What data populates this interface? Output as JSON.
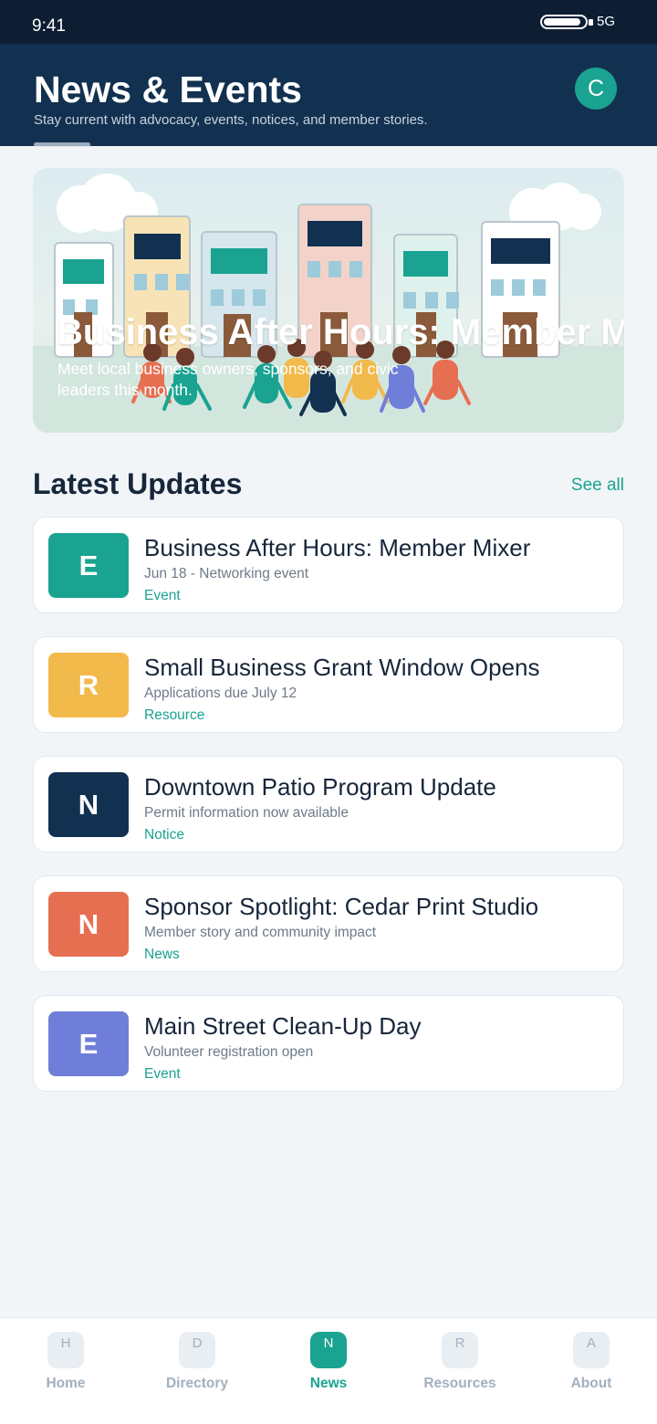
{
  "status": {
    "time": "9:41",
    "network": "5G",
    "battery_level": 0.9
  },
  "header": {
    "title": "News & Events",
    "subtitle": "Stay current with advocacy, events, notices, and member stories.",
    "avatar_initial": "C"
  },
  "hero": {
    "title": "Business After Hours: Member Mixer",
    "subtitle": "Meet local business owners, sponsors, and civic leaders this month."
  },
  "section": {
    "title": "Latest Updates",
    "see_all": "See all"
  },
  "updates": [
    {
      "badge": "E",
      "color": "#1aa391",
      "title": "Business After Hours: Member Mixer",
      "meta": "Jun 18 - Networking event",
      "tag": "Event"
    },
    {
      "badge": "R",
      "color": "#f2b94b",
      "title": "Small Business Grant Window Opens",
      "meta": "Applications due July 12",
      "tag": "Resource"
    },
    {
      "badge": "N",
      "color": "#123150",
      "title": "Downtown Patio Program Update",
      "meta": "Permit information now available",
      "tag": "Notice"
    },
    {
      "badge": "N",
      "color": "#e76f51",
      "title": "Sponsor Spotlight: Cedar Print Studio",
      "meta": "Member story and community impact",
      "tag": "News"
    },
    {
      "badge": "E",
      "color": "#6f7fd9",
      "title": "Main Street Clean-Up Day",
      "meta": "Volunteer registration open",
      "tag": "Event"
    }
  ],
  "tabs": [
    {
      "letter": "H",
      "label": "Home"
    },
    {
      "letter": "D",
      "label": "Directory"
    },
    {
      "letter": "N",
      "label": "News",
      "active": true
    },
    {
      "letter": "R",
      "label": "Resources"
    },
    {
      "letter": "A",
      "label": "About"
    }
  ]
}
